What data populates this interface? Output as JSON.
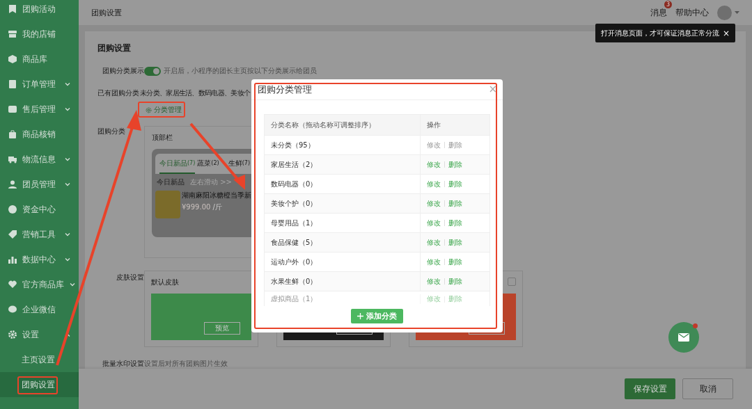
{
  "sidebar": {
    "items": [
      {
        "label": "团购活动",
        "kind": "link",
        "selected": false
      },
      {
        "label": "我的店铺",
        "kind": "link",
        "selected": false
      },
      {
        "label": "商品库",
        "kind": "link",
        "selected": false
      },
      {
        "label": "订单管理",
        "kind": "group",
        "expanded": false,
        "selected": false
      },
      {
        "label": "售后管理",
        "kind": "group",
        "expanded": false,
        "selected": false
      },
      {
        "label": "商品核销",
        "kind": "link",
        "selected": false
      },
      {
        "label": "物流信息",
        "kind": "group",
        "expanded": false,
        "selected": false
      },
      {
        "label": "团员管理",
        "kind": "group",
        "expanded": false,
        "selected": false
      },
      {
        "label": "资金中心",
        "kind": "link",
        "selected": false
      },
      {
        "label": "营销工具",
        "kind": "group",
        "expanded": false,
        "selected": false
      },
      {
        "label": "数据中心",
        "kind": "group",
        "expanded": false,
        "selected": false
      },
      {
        "label": "官方商品库",
        "kind": "group",
        "expanded": false,
        "selected": false
      },
      {
        "label": "企业微信",
        "kind": "link",
        "selected": false
      },
      {
        "label": "设置",
        "kind": "group",
        "expanded": true,
        "selected": false,
        "children": [
          {
            "label": "主页设置",
            "selected": false
          },
          {
            "label": "团购设置",
            "selected": true
          }
        ]
      }
    ]
  },
  "header": {
    "title": "团购设置",
    "links": [
      {
        "label": "消息",
        "badge": "3"
      },
      {
        "label": "帮助中心"
      }
    ],
    "tooltip": "打开消息页面，才可保证消息正常分流",
    "tooltip_close": "×"
  },
  "settings": {
    "title": "团购设置",
    "category_display": {
      "label": "团购分类展示",
      "on": true,
      "hint": "开启后，小程序的团长主页按以下分类展示给团员"
    },
    "existing": {
      "label": "已有团购分类",
      "value": "未分类、家居生活、数码电器、美妆个",
      "manage_link": "分类管理"
    },
    "style": {
      "label": "团购分类",
      "panel_title": "顶部栏",
      "tabs": [
        {
          "label": "今日新品",
          "count": "(7)",
          "selected": true
        },
        {
          "label": "蔬菜",
          "count": "(2)",
          "selected": false
        },
        {
          "label": "生鲜",
          "count": "(7)",
          "selected": false
        }
      ],
      "section": "今日新品",
      "swipe_hint": "左右滑动 >>",
      "product": {
        "name": "湖南麻阳冰糖橙当季新",
        "price": "¥999.00",
        "unit": "/斤"
      }
    },
    "skin": {
      "label": "皮肤设置",
      "skins": [
        {
          "name": "默认皮肤",
          "color": "#3d8a4a",
          "preview": "预览"
        },
        {
          "color": "#1c1c1c"
        },
        {
          "color": "#b9432a",
          "checked": false
        }
      ]
    },
    "watermark": {
      "label": "批量水印设置",
      "hint": "设置后对所有团购图片生效"
    }
  },
  "footer": {
    "save": "保存设置",
    "cancel": "取消"
  },
  "modal": {
    "title": "团购分类管理",
    "close": "×",
    "columns": [
      "分类名称（拖动名称可调整排序）",
      "操作"
    ],
    "rows": [
      {
        "name": "未分类（95）",
        "edit": "修改",
        "delete": "删除",
        "disabled": true
      },
      {
        "name": "家居生活（2）",
        "edit": "修改",
        "delete": "删除",
        "disabled": false
      },
      {
        "name": "数码电器（0）",
        "edit": "修改",
        "delete": "删除",
        "disabled": false
      },
      {
        "name": "美妆个护（0）",
        "edit": "修改",
        "delete": "删除",
        "disabled": false
      },
      {
        "name": "母婴用品（1）",
        "edit": "修改",
        "delete": "删除",
        "disabled": false
      },
      {
        "name": "食品保健（5）",
        "edit": "修改",
        "delete": "删除",
        "disabled": false
      },
      {
        "name": "运动户外（0）",
        "edit": "修改",
        "delete": "删除",
        "disabled": false
      },
      {
        "name": "水果生鲜（0）",
        "edit": "修改",
        "delete": "删除",
        "disabled": false
      },
      {
        "name": "虚拟商品（1）",
        "edit": "修改",
        "delete": "删除",
        "disabled": false
      }
    ],
    "add_button": "添加分类"
  }
}
